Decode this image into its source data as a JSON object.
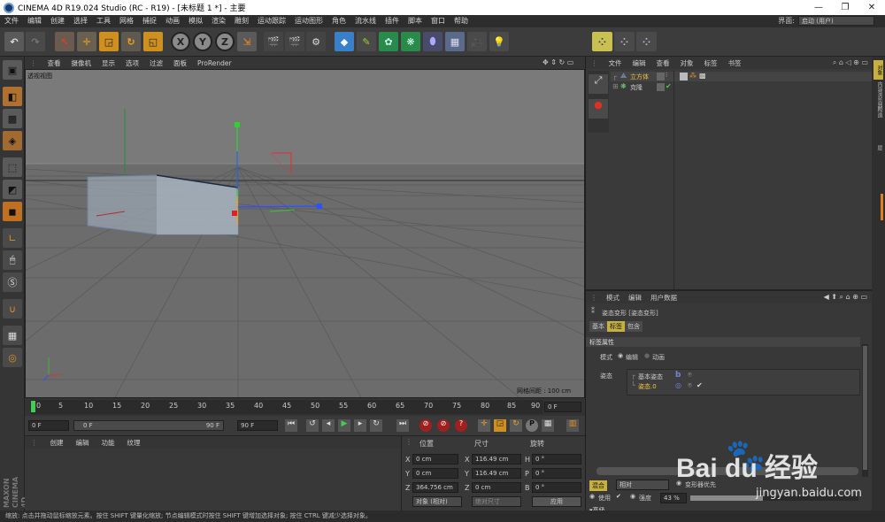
{
  "window": {
    "title": "CINEMA 4D R19.024 Studio (RC - R19) - [未标题 1 *] - 主要",
    "minimize": "—",
    "maximize": "❐",
    "close": "✕"
  },
  "menu": [
    "文件",
    "编辑",
    "创建",
    "选择",
    "工具",
    "网格",
    "捕捉",
    "动画",
    "模拟",
    "渲染",
    "雕刻",
    "运动跟踪",
    "运动图形",
    "角色",
    "流水线",
    "插件",
    "脚本",
    "窗口",
    "帮助"
  ],
  "layout": {
    "label": "界面:",
    "value": "启动 (用户)"
  },
  "toolbar_axes": [
    "X",
    "Y",
    "Z"
  ],
  "viewport": {
    "menu": [
      "查看",
      "摄像机",
      "显示",
      "选项",
      "过滤",
      "面板",
      "ProRender"
    ],
    "name": "透视视图",
    "grid_info": "网格间距 : 100 cm"
  },
  "timeline": {
    "ticks": [
      "0",
      "5",
      "10",
      "15",
      "20",
      "25",
      "30",
      "35",
      "40",
      "45",
      "50",
      "55",
      "60",
      "65",
      "70",
      "75",
      "80",
      "85",
      "90"
    ],
    "frame_end": "0 F"
  },
  "transport": {
    "start": "0 F",
    "current": "0 F",
    "slider_end": "90 F",
    "end": "90 F"
  },
  "material": {
    "menu": [
      "创建",
      "编辑",
      "功能",
      "纹理"
    ]
  },
  "coords": {
    "headers": [
      "位置",
      "尺寸",
      "旋转"
    ],
    "rows": [
      {
        "axis": "X",
        "pos": "0 cm",
        "size_axis": "X",
        "size": "116.49 cm",
        "rot_axis": "H",
        "rot": "0 °"
      },
      {
        "axis": "Y",
        "pos": "0 cm",
        "size_axis": "Y",
        "size": "116.49 cm",
        "rot_axis": "P",
        "rot": "0 °"
      },
      {
        "axis": "Z",
        "pos": "364.756 cm",
        "size_axis": "Z",
        "size": "0 cm",
        "rot_axis": "B",
        "rot": "0 °"
      }
    ],
    "mode": "对象 (相对)",
    "size_mode": "绝对尺寸",
    "apply": "应用"
  },
  "objects": {
    "menu": [
      "文件",
      "编辑",
      "查看",
      "对象",
      "标签",
      "书签"
    ],
    "items": [
      {
        "name": "立方体",
        "color": "#f0c040"
      },
      {
        "name": "克隆",
        "color": "#cfcfcf"
      }
    ]
  },
  "attributes": {
    "menu": [
      "模式",
      "编辑",
      "用户数据"
    ],
    "title": "姿态变形 [姿态变形]",
    "tabs": [
      "基本",
      "标签",
      "包含"
    ],
    "section": "标签属性",
    "mode_label": "模式",
    "mode_options": [
      "编辑",
      "动画"
    ],
    "pose_label": "姿态",
    "pose_items": [
      "基本姿态",
      "姿态.0"
    ],
    "blend_label": "混合",
    "blend_value": "相对",
    "deformer_first": "变形器优先",
    "use_label": "使用",
    "strength_label": "强度",
    "strength_value": "43 %",
    "advanced": "▾高级"
  },
  "right_tabs": [
    "对象",
    "内容浏览器",
    "构造",
    "层"
  ],
  "status": "缩放: 点击并拖动鼠标缩放元素。按住 SHIFT 键量化缩放; 节点编辑模式时按住 SHIFT 键增加选择对象; 按住 CTRL 键减少选择对象。",
  "brand": {
    "line1": "MAXON",
    "line2": "CINEMA 4D"
  },
  "watermark": {
    "logo": "Bai du 经验",
    "url": "jingyan.baidu.com"
  },
  "colors": {
    "accent": "#f0c040",
    "gizmo_x": "#e03030",
    "gizmo_y": "#30d030",
    "gizmo_z": "#3050ff"
  }
}
